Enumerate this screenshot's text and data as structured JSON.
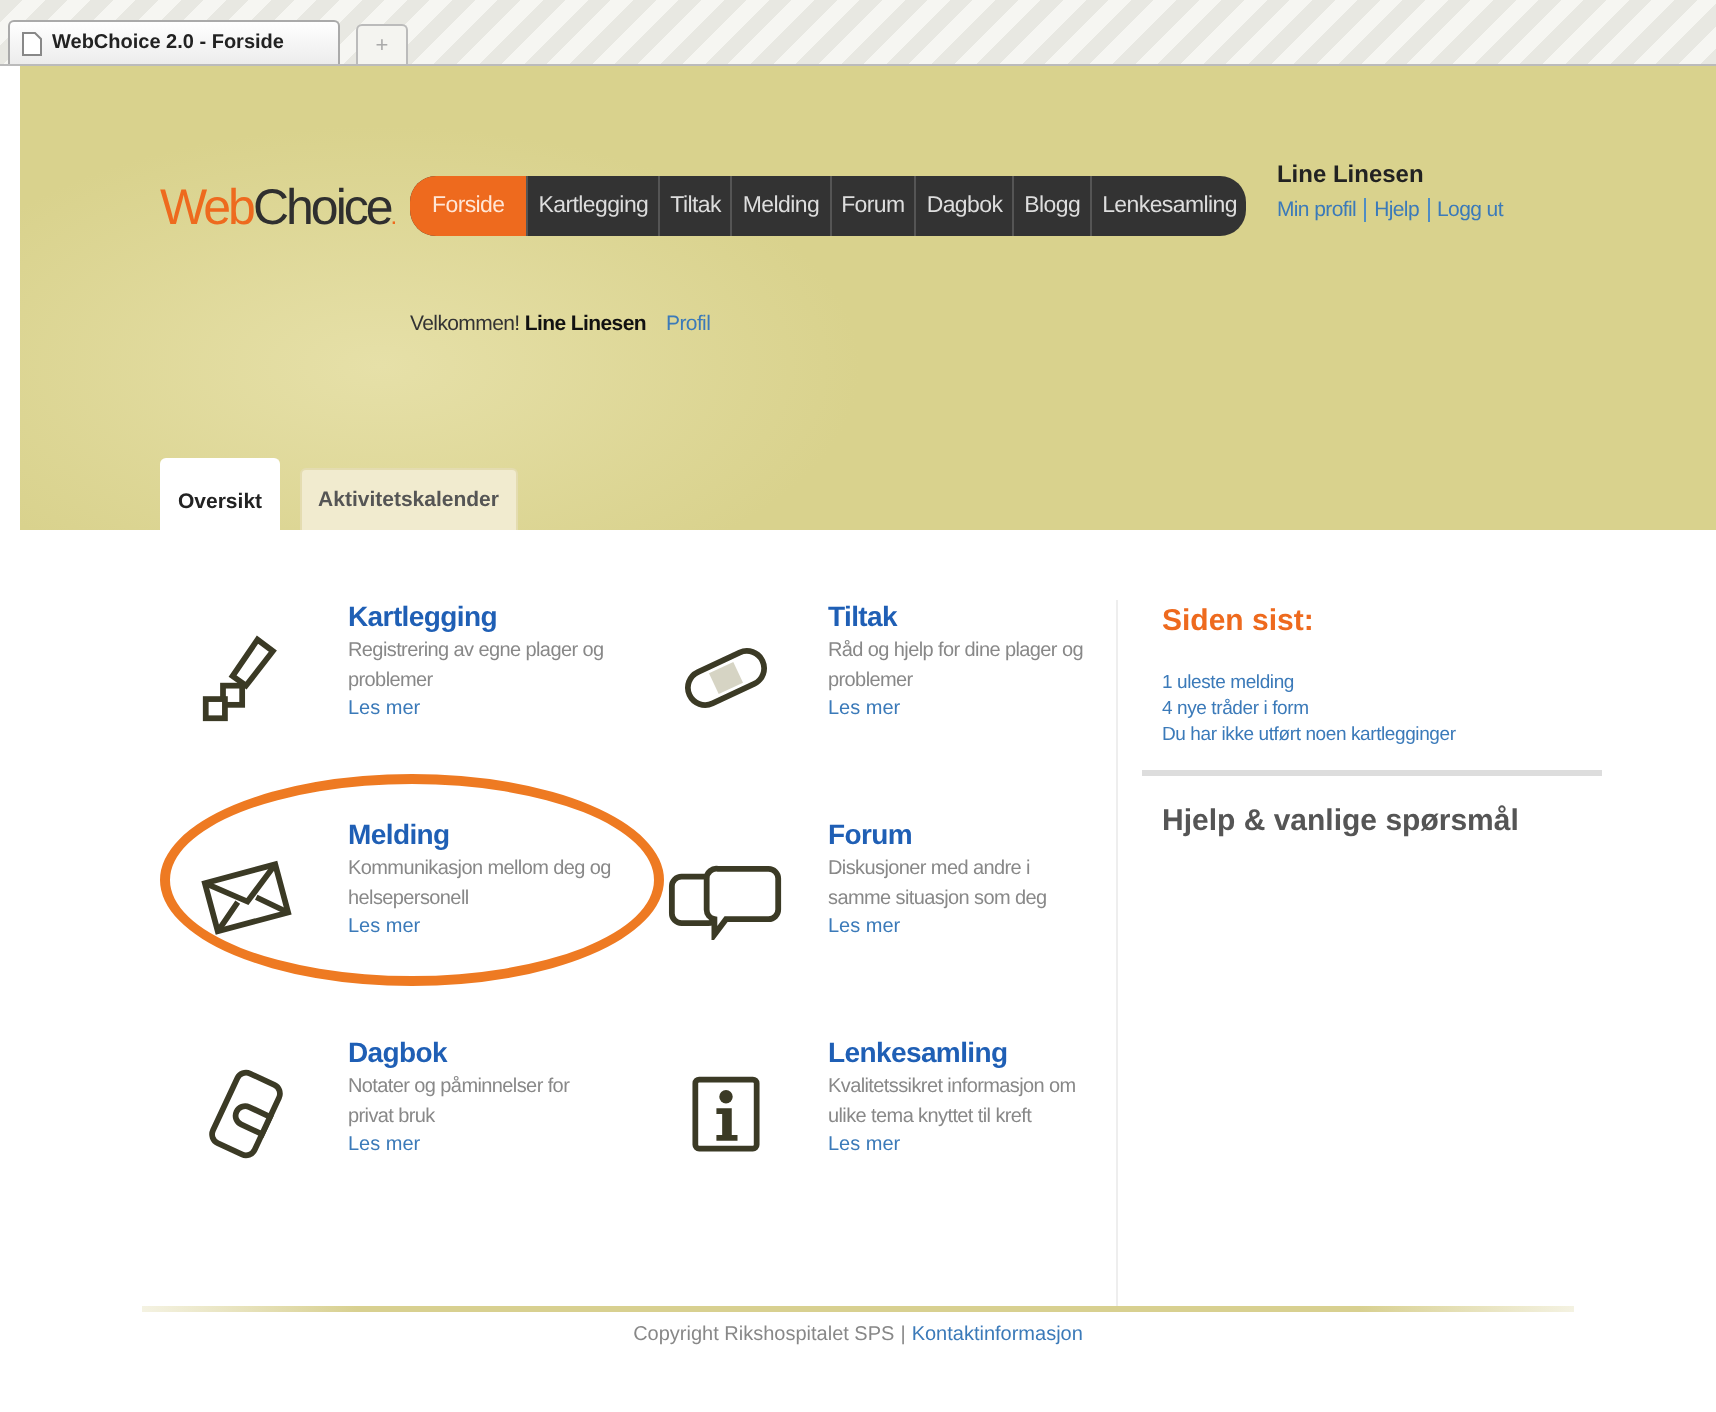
{
  "browser_tab": {
    "title": "WebChoice 2.0 - Forside",
    "new_tab": "+"
  },
  "logo": {
    "part_1": "Web",
    "part_2": "Choice",
    "dot": "."
  },
  "nav": [
    {
      "label": "Forside",
      "selected": true
    },
    {
      "label": "Kartlegging",
      "selected": false
    },
    {
      "label": "Tiltak",
      "selected": false
    },
    {
      "label": "Melding",
      "selected": false
    },
    {
      "label": "Forum",
      "selected": false
    },
    {
      "label": "Dagbok",
      "selected": false
    },
    {
      "label": "Blogg",
      "selected": false
    },
    {
      "label": "Lenkesamling",
      "selected": false
    }
  ],
  "user": {
    "name": "Line Linesen",
    "links": [
      "Min profil",
      "Hjelp",
      "Logg ut"
    ]
  },
  "welcome": {
    "text": "Velkommen!",
    "name": "Line Linesen",
    "link": "Profil"
  },
  "tabs": [
    {
      "label": "Oversikt",
      "selected": true
    },
    {
      "label": "Aktivitetskalender",
      "selected": false
    }
  ],
  "modules": [
    {
      "title": "Kartlegging",
      "description": "Registrering av egne plager og problemer",
      "link": "Les mer",
      "highlighted": false
    },
    {
      "title": "Tiltak",
      "description": "Råd og hjelp for dine plager og problemer",
      "link": "Les mer",
      "highlighted": false
    },
    {
      "title": "Melding",
      "description": "Kommunikasjon mellom deg og helsepersonell",
      "link": "Les mer",
      "highlighted": true
    },
    {
      "title": "Forum",
      "description": "Diskusjoner med andre i samme situasjon som deg",
      "link": "Les mer",
      "highlighted": false
    },
    {
      "title": "Dagbok",
      "description": "Notater og påminnelser for privat bruk",
      "link": "Les mer",
      "highlighted": false
    },
    {
      "title": "Lenkesamling",
      "description": "Kvalitetssikret informasjon om ulike tema knyttet til kreft",
      "link": "Les mer",
      "highlighted": false
    }
  ],
  "since_last": {
    "heading": "Siden sist:",
    "items": [
      "1 uleste melding",
      "4 nye tråder i form",
      "Du har ikke utført noen kartlegginger"
    ]
  },
  "help": {
    "heading": "Hjelp & vanlige spørsmål"
  },
  "footer": {
    "copyright": "Copyright Rikshospitalet SPS",
    "separator": "|",
    "link": "Kontaktinformasjon"
  }
}
